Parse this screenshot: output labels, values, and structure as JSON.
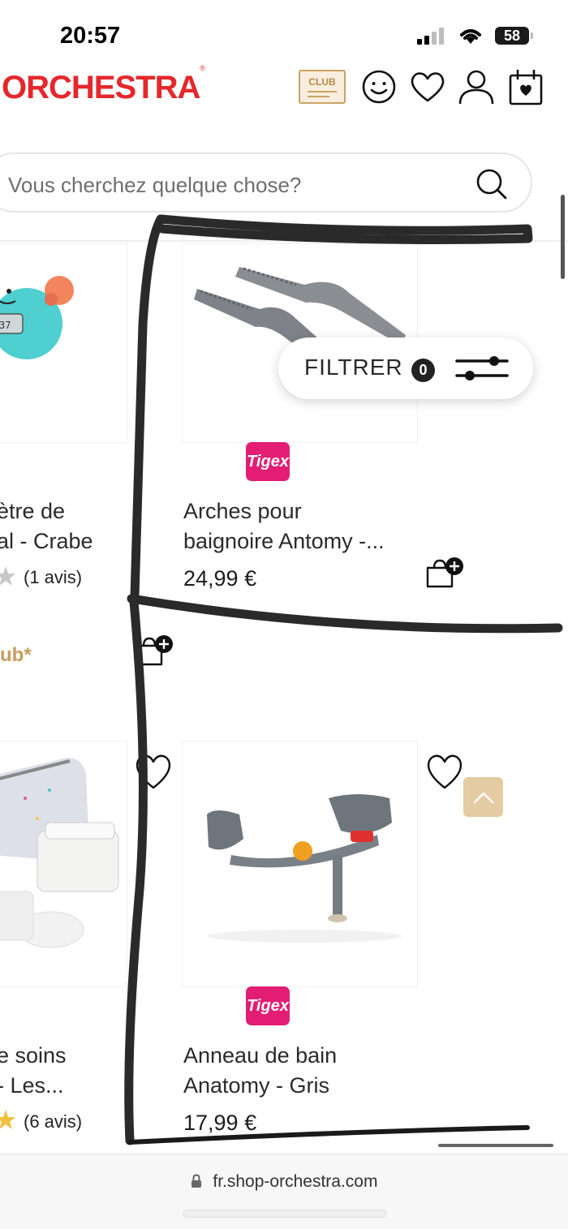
{
  "status_bar": {
    "time": "20:57",
    "battery": "58"
  },
  "header": {
    "logo": "ORCHESTRA",
    "club_badge": "CLUB"
  },
  "search": {
    "placeholder": "Vous cherchez quelque chose?"
  },
  "filter": {
    "label": "FILTRER",
    "count": "0"
  },
  "products": [
    {
      "title_lines": [
        "ètre de",
        "al - Crabe"
      ],
      "reviews": "(1 avis)",
      "club_text": "ub*"
    },
    {
      "brand": "Tigex",
      "title_lines": [
        "Arches pour",
        "baignoire Antomy -..."
      ],
      "price": "24,99 €"
    },
    {
      "title_lines": [
        "e soins",
        "- Les..."
      ],
      "reviews": "(6 avis)"
    },
    {
      "brand": "Tigex",
      "title_lines": [
        "Anneau de bain",
        "Anatomy - Gris"
      ],
      "price": "17,99 €"
    }
  ],
  "browser": {
    "url": "fr.shop-orchestra.com"
  },
  "colors": {
    "brand_red": "#e4282c",
    "club_gold": "#c8a266",
    "tigex_pink": "#e31d73"
  },
  "icons": [
    "signal-icon",
    "wifi-icon",
    "battery-icon",
    "club-icon",
    "smiley-icon",
    "heart-icon",
    "user-icon",
    "calendar-heart-icon",
    "search-icon",
    "filter-sliders-icon",
    "add-to-cart-icon",
    "star-icon",
    "chevron-up-icon",
    "lock-icon"
  ]
}
